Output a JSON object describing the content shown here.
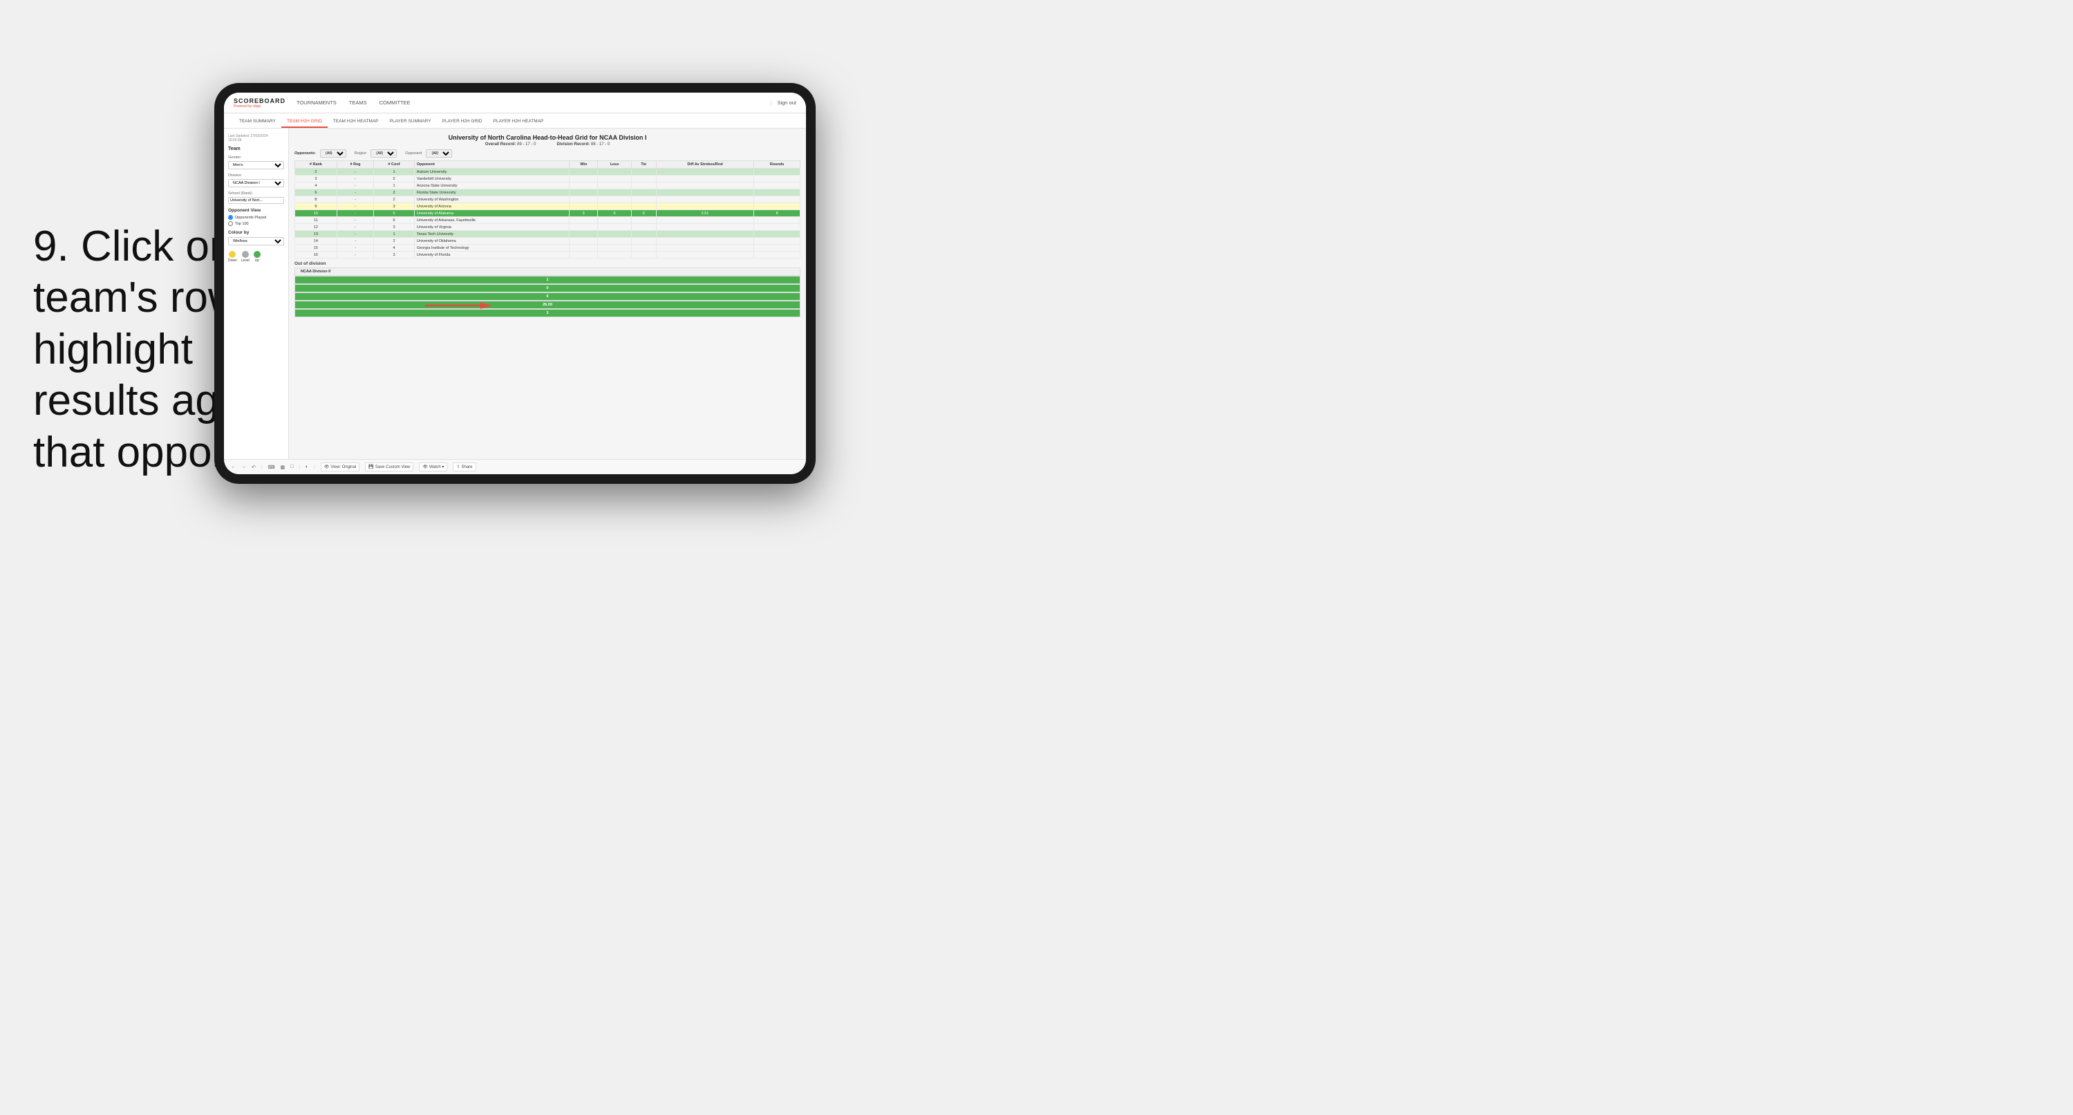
{
  "instruction": {
    "step": "9.",
    "text": "Click on a team's row to highlight results against that opponent"
  },
  "tablet": {
    "topNav": {
      "logo": "SCOREBOARD",
      "powered_by": "Powered by ",
      "powered_brand": "clippi",
      "nav_items": [
        "TOURNAMENTS",
        "TEAMS",
        "COMMITTEE"
      ],
      "sign_out_sep": "|",
      "sign_out": "Sign out"
    },
    "subNav": {
      "tabs": [
        "TEAM SUMMARY",
        "TEAM H2H GRID",
        "TEAM H2H HEATMAP",
        "PLAYER SUMMARY",
        "PLAYER H2H GRID",
        "PLAYER H2H HEATMAP"
      ],
      "active_tab": "TEAM H2H GRID"
    },
    "leftPanel": {
      "last_updated": "Last Updated: 27/03/2024",
      "time": "16:55:38",
      "team_label": "Team",
      "gender_label": "Gender",
      "gender_value": "Men's",
      "division_label": "Division",
      "division_value": "NCAA Division I",
      "school_label": "School (Rank)",
      "school_value": "University of Nort...",
      "opponent_view_title": "Opponent View",
      "radio1": "Opponents Played",
      "radio2": "Top 100",
      "colour_by_title": "Colour by",
      "colour_by_value": "Win/loss",
      "legend_down": "Down",
      "legend_level": "Level",
      "legend_up": "Up",
      "legend_down_color": "#f4d03f",
      "legend_level_color": "#aaa",
      "legend_up_color": "#4caf50"
    },
    "grid": {
      "title": "University of North Carolina Head-to-Head Grid for NCAA Division I",
      "overall_record_label": "Overall Record:",
      "overall_record": "89 - 17 - 0",
      "division_record_label": "Division Record:",
      "division_record": "88 - 17 - 0",
      "filter_opponents_label": "Opponents:",
      "filter_opponents_value": "(All)",
      "filter_region_label": "Region",
      "filter_region_value": "(All)",
      "filter_opponent_label": "Opponent",
      "filter_opponent_value": "(All)",
      "col_headers": [
        "# Rank",
        "# Reg",
        "# Conf",
        "Opponent",
        "Win",
        "Loss",
        "Tie",
        "Diff Av Strokes/Rnd",
        "Rounds"
      ],
      "rows": [
        {
          "rank": "2",
          "reg": "-",
          "conf": "1",
          "opponent": "Auburn University",
          "win": "",
          "loss": "",
          "tie": "",
          "diff": "",
          "rounds": "",
          "highlight": "light-green"
        },
        {
          "rank": "3",
          "reg": "-",
          "conf": "2",
          "opponent": "Vanderbilt University",
          "win": "",
          "loss": "",
          "tie": "",
          "diff": "",
          "rounds": "",
          "highlight": "none"
        },
        {
          "rank": "4",
          "reg": "-",
          "conf": "1",
          "opponent": "Arizona State University",
          "win": "",
          "loss": "",
          "tie": "",
          "diff": "",
          "rounds": "",
          "highlight": "none"
        },
        {
          "rank": "6",
          "reg": "-",
          "conf": "2",
          "opponent": "Florida State University",
          "win": "",
          "loss": "",
          "tie": "",
          "diff": "",
          "rounds": "",
          "highlight": "light-green"
        },
        {
          "rank": "8",
          "reg": "-",
          "conf": "2",
          "opponent": "University of Washington",
          "win": "",
          "loss": "",
          "tie": "",
          "diff": "",
          "rounds": "",
          "highlight": "none"
        },
        {
          "rank": "9",
          "reg": "-",
          "conf": "3",
          "opponent": "University of Arizona",
          "win": "",
          "loss": "",
          "tie": "",
          "diff": "",
          "rounds": "",
          "highlight": "yellow"
        },
        {
          "rank": "10",
          "reg": "-",
          "conf": "5",
          "opponent": "University of Alabama",
          "win": "3",
          "loss": "0",
          "tie": "0",
          "diff": "2.61",
          "rounds": "8",
          "highlight": "green"
        },
        {
          "rank": "11",
          "reg": "-",
          "conf": "6",
          "opponent": "University of Arkansas, Fayetteville",
          "win": "",
          "loss": "",
          "tie": "",
          "diff": "",
          "rounds": "",
          "highlight": "none"
        },
        {
          "rank": "12",
          "reg": "-",
          "conf": "3",
          "opponent": "University of Virginia",
          "win": "",
          "loss": "",
          "tie": "",
          "diff": "",
          "rounds": "",
          "highlight": "none"
        },
        {
          "rank": "13",
          "reg": "-",
          "conf": "1",
          "opponent": "Texas Tech University",
          "win": "",
          "loss": "",
          "tie": "",
          "diff": "",
          "rounds": "",
          "highlight": "light-green"
        },
        {
          "rank": "14",
          "reg": "-",
          "conf": "2",
          "opponent": "University of Oklahoma",
          "win": "",
          "loss": "",
          "tie": "",
          "diff": "",
          "rounds": "",
          "highlight": "none"
        },
        {
          "rank": "15",
          "reg": "-",
          "conf": "4",
          "opponent": "Georgia Institute of Technology",
          "win": "",
          "loss": "",
          "tie": "",
          "diff": "",
          "rounds": "",
          "highlight": "none"
        },
        {
          "rank": "16",
          "reg": "-",
          "conf": "3",
          "opponent": "University of Florida",
          "win": "",
          "loss": "",
          "tie": "",
          "diff": "",
          "rounds": "",
          "highlight": "none"
        }
      ],
      "out_of_division_title": "Out of division",
      "out_div_label": "NCAA Division II",
      "out_div_win": "1",
      "out_div_loss": "0",
      "out_div_tie": "0",
      "out_div_diff": "26.00",
      "out_div_rounds": "3"
    },
    "toolbar": {
      "view_label": "View: Original",
      "save_label": "Save Custom View",
      "watch_label": "Watch ▾",
      "share_label": "Share"
    }
  }
}
